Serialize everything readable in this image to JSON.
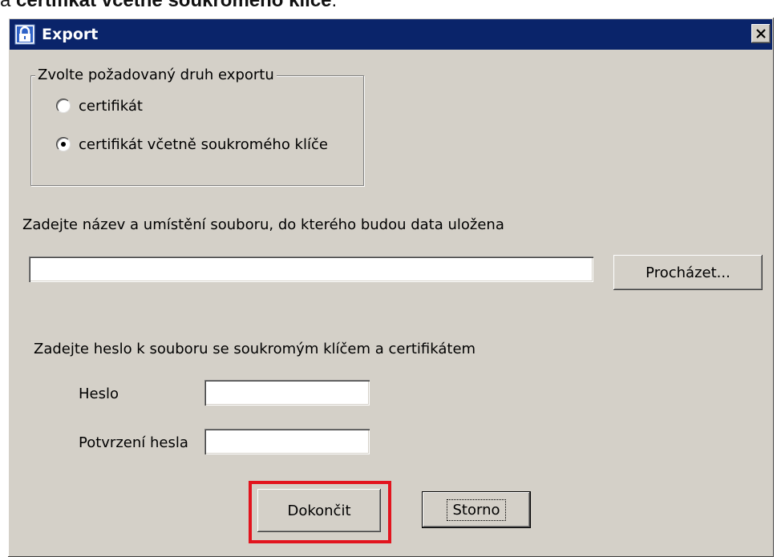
{
  "caption": {
    "prefix": "a ",
    "bold": "certifikát včetně soukromého klíče",
    "suffix": "."
  },
  "window": {
    "title": "Export",
    "close_label": "×",
    "icon": "certificate-lock-icon"
  },
  "export_type": {
    "legend": "Zvolte požadovaný druh exportu",
    "options": [
      {
        "label": "certifikát",
        "selected": false
      },
      {
        "label": "certifikát včetně soukromého klíče",
        "selected": true
      }
    ]
  },
  "file": {
    "prompt": "Zadejte název a umístění souboru, do kterého budou data uložena",
    "path_value": "",
    "browse_label": "Procházet..."
  },
  "password": {
    "prompt": "Zadejte heslo k souboru se soukromým klíčem a certifikátem",
    "password_label": "Heslo",
    "confirm_label": "Potvrzení hesla"
  },
  "actions": {
    "finish_label": "Dokončit",
    "cancel_label": "Storno"
  },
  "colors": {
    "titlebar": "#0a246a",
    "dialog_bg": "#d4d0c8",
    "highlight": "#e2141e"
  }
}
